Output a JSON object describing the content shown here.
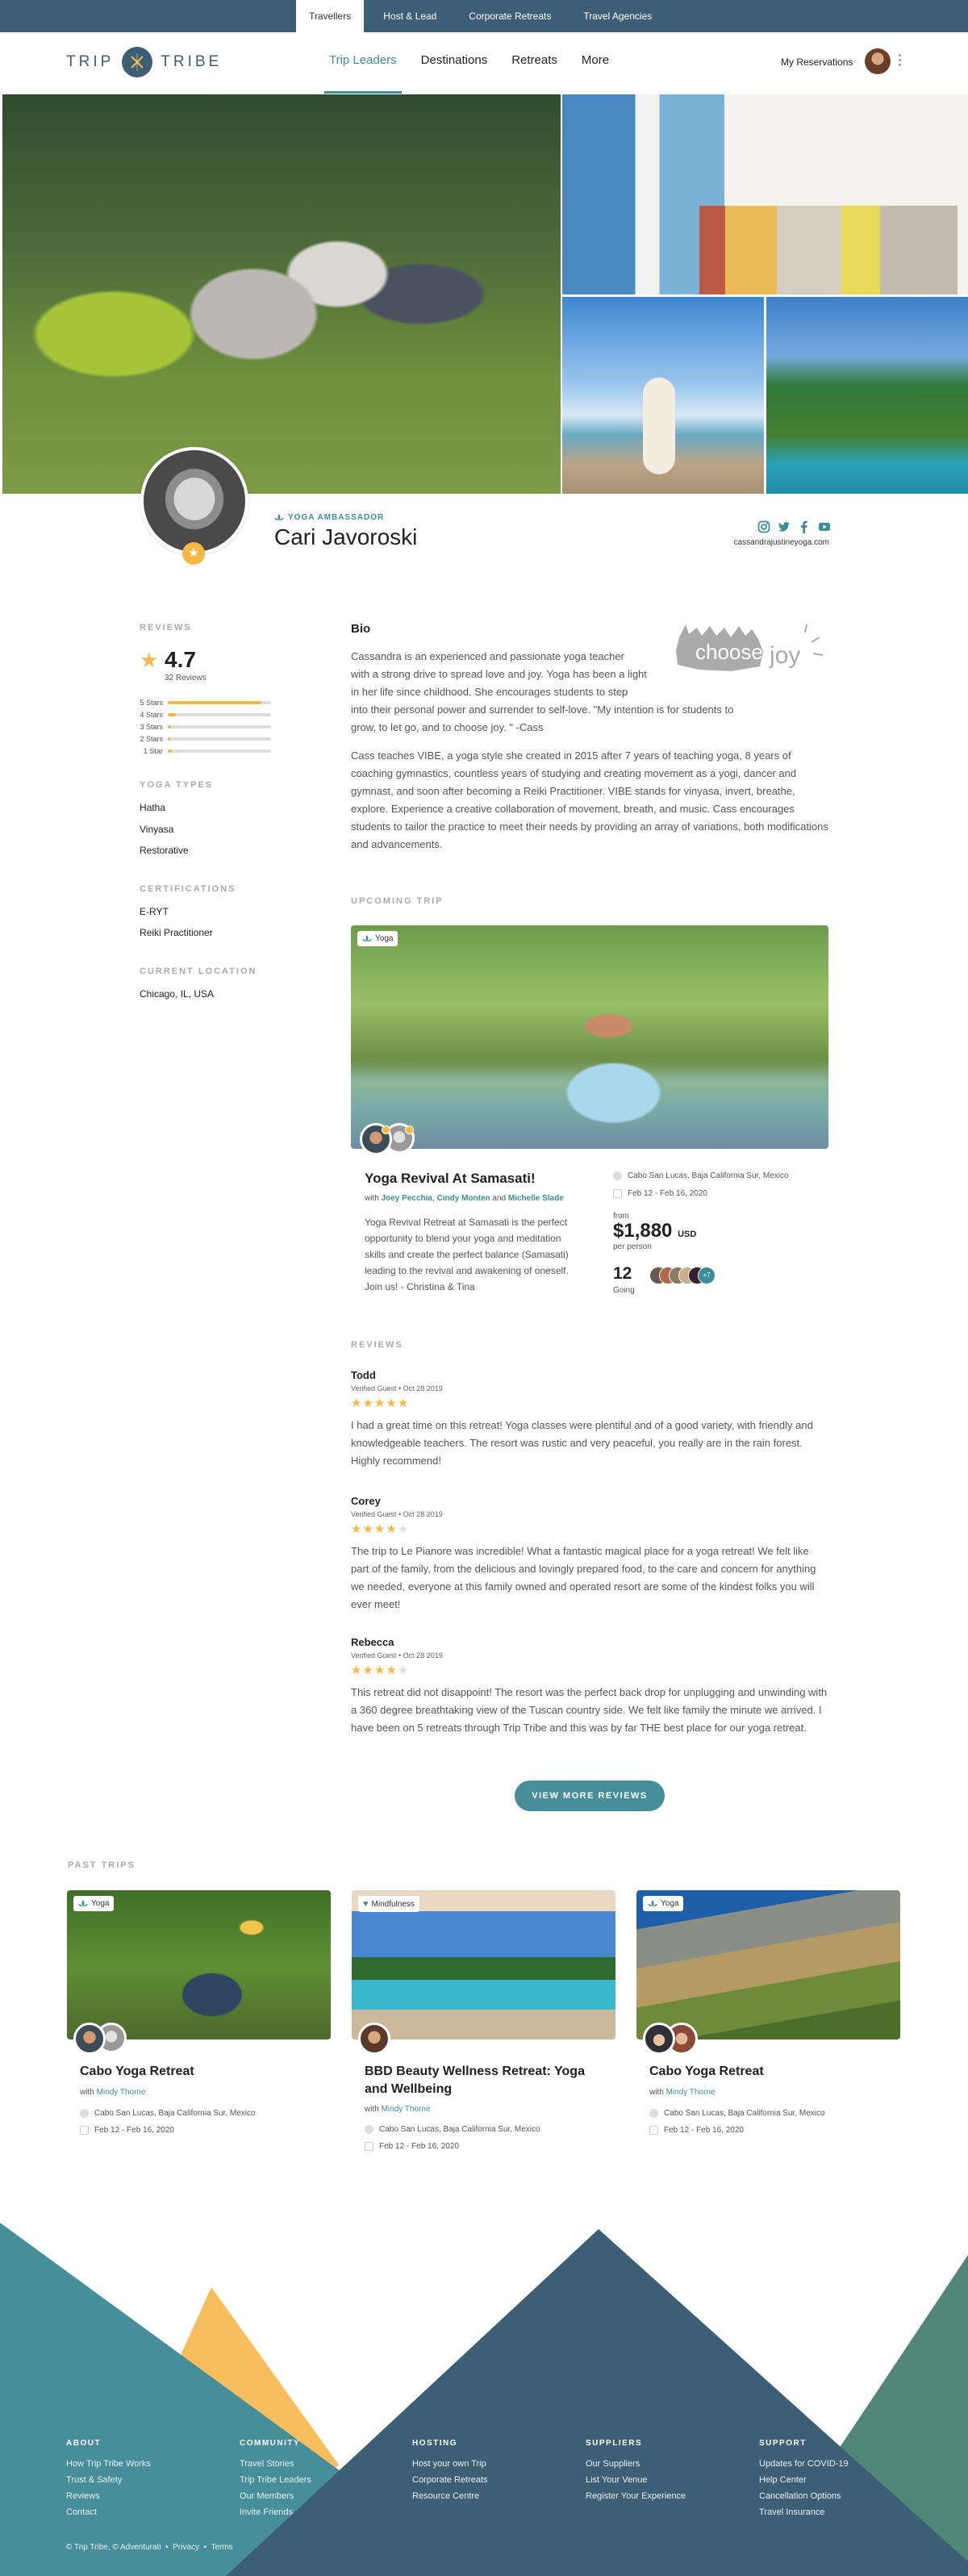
{
  "topbar": {
    "tabs": [
      {
        "label": "Travellers",
        "active": true
      },
      {
        "label": "Host & Lead"
      },
      {
        "label": "Corporate Retreats"
      },
      {
        "label": "Travel Agencies"
      }
    ]
  },
  "header": {
    "logo_left": "TRIP",
    "logo_right": "TRIBE",
    "nav": [
      {
        "label": "Trip Leaders",
        "active": true
      },
      {
        "label": "Destinations"
      },
      {
        "label": "Retreats"
      },
      {
        "label": "More"
      }
    ],
    "reservations": "My Reservations"
  },
  "profile": {
    "role": "YOGA AMBASSADOR",
    "name": "Cari Javoroski",
    "website": "cassandrajustineyoga.com",
    "socials": [
      "instagram-icon",
      "twitter-icon",
      "facebook-icon",
      "youtube-icon"
    ]
  },
  "sidebar": {
    "reviews_label": "REVIEWS",
    "rating": "4.7",
    "review_count": "32 Reviews",
    "breakdown": [
      {
        "label": "5 Stars",
        "fraction": 0.91
      },
      {
        "label": "4 Stars",
        "fraction": 0.08
      },
      {
        "label": "3 Stars",
        "fraction": 0.03
      },
      {
        "label": "2 Stars",
        "fraction": 0.02
      },
      {
        "label": "1 Star",
        "fraction": 0.04
      }
    ],
    "yoga_types_label": "YOGA TYPES",
    "yoga_types": [
      "Hatha",
      "Vinyasa",
      "Restorative"
    ],
    "certifications_label": "CERTIFICATIONS",
    "certifications": [
      "E-RYT",
      "Reiki Practitioner"
    ],
    "location_label": "CURRENT LOCATION",
    "location": "Chicago, IL, USA"
  },
  "bio": {
    "title": "Bio",
    "logo_text_1": "choose",
    "logo_text_2": "joy",
    "p1_lines": [
      "Cassandra is an experienced and passionate yoga teacher",
      "with a strong drive to spread love and joy. Yoga has been a light",
      "in her life since childhood. She encourages students to step",
      "into their personal power and surrender to self-love. \"My intention is for students to",
      "grow, to let go, and to choose joy. \" -Cass"
    ],
    "p2": "Cass teaches VIBE, a yoga style she created in 2015 after 7 years of teaching yoga, 8 years of coaching gymnastics, countless years of studying and creating movement as a yogi, dancer and gymnast, and soon after becoming a Reiki Practitioner. VIBE stands for vinyasa, invert, breathe, explore. Experience a creative collaboration of movement, breath, and music. Cass encourages students to tailor the practice to meet their needs by providing an array of variations, both modifications and advancements."
  },
  "upcoming": {
    "label": "UPCOMING TRIP",
    "badge": "Yoga",
    "title": "Yoga Revival At Samasati!",
    "with": "with",
    "leaders": [
      "Joey Pecchia",
      "Cindy Monten",
      "Michelle Slade"
    ],
    "comma": ",",
    "and": "and",
    "description": "Yoga Revival Retreat at Samasati is the perfect opportunity to blend your yoga and meditation skills and create the perfect balance (Samasati) leading to the revival and awakening of oneself. Join us! - Christina & Tina",
    "location": "Cabo San Lucas, Baja California Sur, Mexico",
    "dates": "Feb 12 - Feb 16, 2020",
    "from": "from",
    "price": "$1,880",
    "currency": "USD",
    "per": "per person",
    "going_count": "12",
    "going_label": "Going",
    "more_attendees": "+7"
  },
  "reviews": {
    "label": "REVIEWS",
    "items": [
      {
        "name": "Todd",
        "meta": "Verified Guest  •  Oct 28 2019",
        "stars": 5,
        "text": "I had a great time on this retreat! Yoga classes were plentiful and of a good variety, with friendly and knowledgeable teachers. The resort was rustic and very peaceful, you really are in the rain forest. Highly recommend!"
      },
      {
        "name": "Corey",
        "meta": "Verified Guest  •  Oct 28 2019",
        "stars": 4,
        "text": "The trip to Le Pianore was incredible! What a fantastic magical place for a yoga retreat! We felt like part of the family, from the delicious and lovingly prepared food, to the care and concern for anything we needed, everyone at this family owned and operated resort are some of the kindest folks you will ever meet!"
      },
      {
        "name": "Rebecca",
        "meta": "Verified Guest  •  Oct 28 2019",
        "stars": 4,
        "text": "This retreat did not disappoint! The resort was the perfect back drop for unplugging and unwinding with a 360 degree breathtaking view of the Tuscan country side. We felt like family the minute we arrived. I have been on 5 retreats through Trip Tribe and this was by far THE best place for our yoga retreat."
      }
    ],
    "more_button": "VIEW MORE REVIEWS"
  },
  "past_trips": {
    "label": "PAST TRIPS",
    "items": [
      {
        "badge": "Yoga",
        "title": "Cabo Yoga Retreat",
        "with": "with",
        "leader": "Mindy Thorne",
        "location": "Cabo San Lucas, Baja California Sur, Mexico",
        "dates": "Feb 12 - Feb 16, 2020"
      },
      {
        "badge": "Mindfulness",
        "title": "BBD Beauty Wellness Retreat: Yoga and Wellbeing",
        "with": "with",
        "leader": "Mindy Thorne",
        "location": "Cabo San Lucas, Baja California Sur, Mexico",
        "dates": "Feb 12 - Feb 16, 2020"
      },
      {
        "badge": "Yoga",
        "title": "Cabo Yoga Retreat",
        "with": "with",
        "leader": "Mindy Thorne",
        "location": "Cabo San Lucas, Baja California Sur, Mexico",
        "dates": "Feb 12 - Feb 16, 2020"
      }
    ]
  },
  "footer": {
    "columns": [
      {
        "heading": "ABOUT",
        "links": [
          "How Trip Tribe Works",
          "Trust & Safety",
          "Reviews",
          "Contact"
        ]
      },
      {
        "heading": "COMMUNITY",
        "links": [
          "Travel Stories",
          "Trip Tribe Leaders",
          "Our Members",
          "Invite Friends"
        ]
      },
      {
        "heading": "HOSTING",
        "links": [
          "Host your own Trip",
          "Corporate Retreats",
          "Resource Centre"
        ]
      },
      {
        "heading": "SUPPLIERS",
        "links": [
          "Our Suppliers",
          "List Your Venue",
          "Register Your Experience"
        ]
      },
      {
        "heading": "SUPPORT",
        "links": [
          "Updates for COVID-19",
          "Help Center",
          "Cancellation Options",
          "Travel Insurance"
        ]
      }
    ],
    "copyright": "© Trip Tribe, © Adventurati",
    "sep": "•",
    "privacy": "Privacy",
    "terms": "Terms"
  },
  "colors": {
    "navy": "#3d5f75",
    "teal": "#3a8d99",
    "star": "#f6b845",
    "footer_teal": "#468f9a",
    "footer_green": "#4f8676",
    "footer_yellow": "#f8be5e"
  }
}
